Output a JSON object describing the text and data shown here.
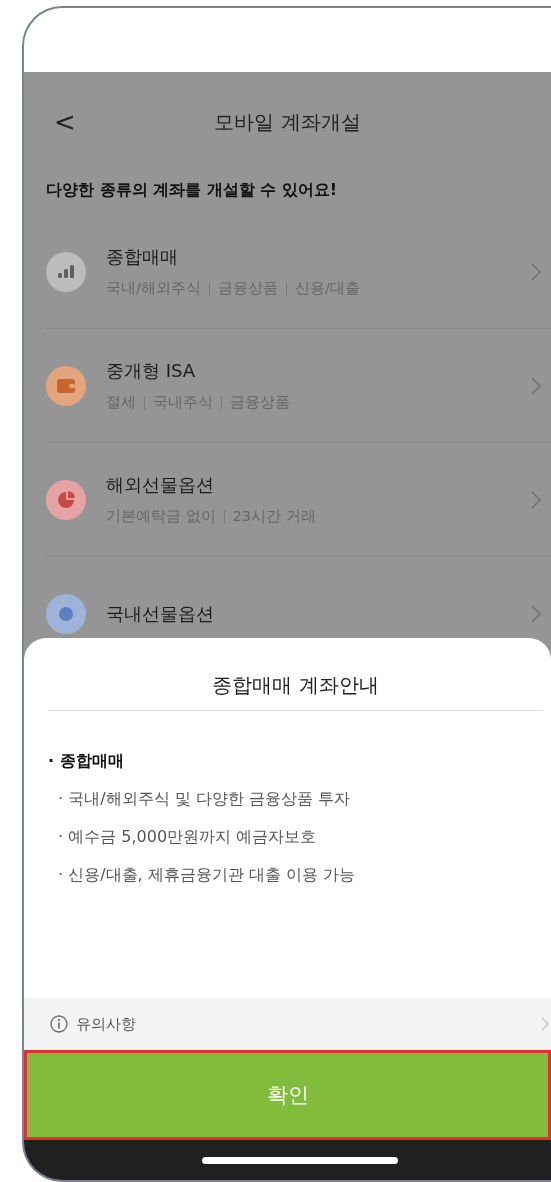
{
  "header": {
    "back": "<",
    "title": "모바일 계좌개설"
  },
  "headline": "다양한 종류의 계좌를 개설할 수 있어요!",
  "accounts": [
    {
      "kind": "chart",
      "title": "종합매매",
      "tags": [
        "국내/해외주식",
        "금융상품",
        "신용/대출"
      ],
      "color": "#bcbcbc"
    },
    {
      "kind": "wallet",
      "title": "중개형 ISA",
      "tags": [
        "절세",
        "국내주식",
        "금융상품"
      ],
      "color": "#e3a47e"
    },
    {
      "kind": "pie",
      "title": "해외선물옵션",
      "tags": [
        "기본예탁금 없이",
        "23시간 거래"
      ],
      "color": "#e6a3a3"
    },
    {
      "kind": "globe",
      "title": "국내선물옵션",
      "color": "#9db3d8"
    }
  ],
  "sheet": {
    "title": "종합매매 계좌안내",
    "section": "· 종합매매",
    "bullets": [
      "· 국내/해외주식 및 다양한 금융상품 투자",
      "· 예수금 5,000만원까지 예금자보호",
      "· 신용/대출, 제휴금융기관 대출 이용 가능"
    ],
    "notice": "유의사항",
    "confirm": "확인"
  }
}
